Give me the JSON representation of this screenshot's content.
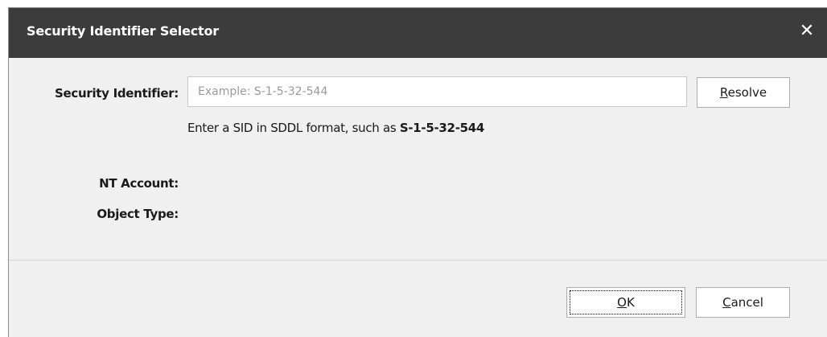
{
  "dialog": {
    "title": "Security Identifier Selector",
    "close_glyph": "✕"
  },
  "form": {
    "sid_label": "Security Identifier:",
    "sid_placeholder": "Example: S-1-5-32-544",
    "sid_value": "",
    "hint_text": "Enter a SID in SDDL format, such as ",
    "hint_example": "S-1-5-32-544",
    "nt_account_label": "NT Account:",
    "object_type_label": "Object Type:"
  },
  "buttons": {
    "resolve_mnemonic": "R",
    "resolve_rest": "esolve",
    "ok_mnemonic": "O",
    "ok_rest": "K",
    "cancel_mnemonic": "C",
    "cancel_rest": "ancel"
  }
}
